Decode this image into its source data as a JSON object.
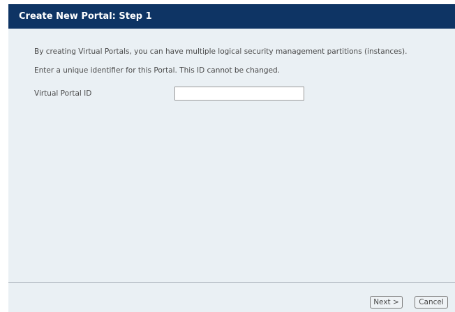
{
  "dialog": {
    "title": "Create New Portal: Step 1",
    "description_line1": "By creating Virtual Portals, you can have multiple logical security management partitions (instances).",
    "description_line2": "Enter a unique identifier for this Portal. This ID cannot be changed.",
    "field": {
      "label": "Virtual Portal ID",
      "value": "",
      "placeholder": ""
    },
    "buttons": {
      "next_label": "Next >",
      "cancel_label": "Cancel"
    }
  },
  "colors": {
    "title_bar": "#0e3464",
    "panel_background": "#eaf0f4",
    "text": "#4a4a4a"
  }
}
